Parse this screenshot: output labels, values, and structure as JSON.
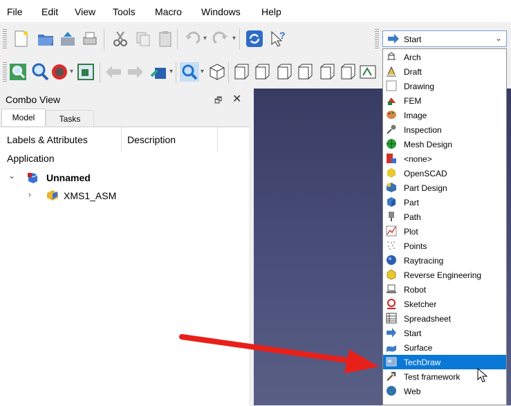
{
  "menubar": {
    "items": [
      "File",
      "Edit",
      "View",
      "Tools",
      "Macro",
      "Windows",
      "Help"
    ]
  },
  "workbench": {
    "current": "Start",
    "items": [
      {
        "label": "Arch",
        "icon": "arch-icon",
        "color": "#888888"
      },
      {
        "label": "Draft",
        "icon": "draft-icon",
        "color": "#c9a227"
      },
      {
        "label": "Drawing",
        "icon": "drawing-icon",
        "color": "#ffffff"
      },
      {
        "label": "FEM",
        "icon": "fem-icon",
        "color": "#c0392b"
      },
      {
        "label": "Image",
        "icon": "image-icon",
        "color": "#d18b4a"
      },
      {
        "label": "Inspection",
        "icon": "inspection-icon",
        "color": "#555555"
      },
      {
        "label": "Mesh Design",
        "icon": "mesh-design-icon",
        "color": "#2e9e3a"
      },
      {
        "label": "<none>",
        "icon": "none-icon",
        "color": "#d0302a"
      },
      {
        "label": "OpenSCAD",
        "icon": "openscad-icon",
        "color": "#e8c830"
      },
      {
        "label": "Part Design",
        "icon": "part-design-icon",
        "color": "#3a6fb0"
      },
      {
        "label": "Part",
        "icon": "part-icon",
        "color": "#3d7bc8"
      },
      {
        "label": "Path",
        "icon": "path-icon",
        "color": "#888888"
      },
      {
        "label": "Plot",
        "icon": "plot-icon",
        "color": "#d04040"
      },
      {
        "label": "Points",
        "icon": "points-icon",
        "color": "#999999"
      },
      {
        "label": "Raytracing",
        "icon": "raytracing-icon",
        "color": "#2b5fb0"
      },
      {
        "label": "Reverse Engineering",
        "icon": "reverse-engineering-icon",
        "color": "#e8c830"
      },
      {
        "label": "Robot",
        "icon": "robot-icon",
        "color": "#777777"
      },
      {
        "label": "Sketcher",
        "icon": "sketcher-icon",
        "color": "#d02020"
      },
      {
        "label": "Spreadsheet",
        "icon": "spreadsheet-icon",
        "color": "#444444"
      },
      {
        "label": "Start",
        "icon": "start-icon",
        "color": "#3d7bc8"
      },
      {
        "label": "Surface",
        "icon": "surface-icon",
        "color": "#3d7bc8"
      },
      {
        "label": "TechDraw",
        "icon": "techdraw-icon",
        "color": "#8fb0d8",
        "selected": true
      },
      {
        "label": "Test framework",
        "icon": "test-framework-icon",
        "color": "#7a5a30"
      },
      {
        "label": "Web",
        "icon": "web-icon",
        "color": "#2e7d32"
      }
    ]
  },
  "combo_view": {
    "title": "Combo View",
    "tabs": [
      "Model",
      "Tasks"
    ],
    "columns": [
      "Labels & Attributes",
      "Description"
    ],
    "root": "Application",
    "document": "Unnamed",
    "child": "XMS1_ASM"
  },
  "colors": {
    "selection": "#0a78d7",
    "view_top": "#383c63",
    "view_bottom": "#5a5f85",
    "pointer_arrow": "#e8201a"
  }
}
